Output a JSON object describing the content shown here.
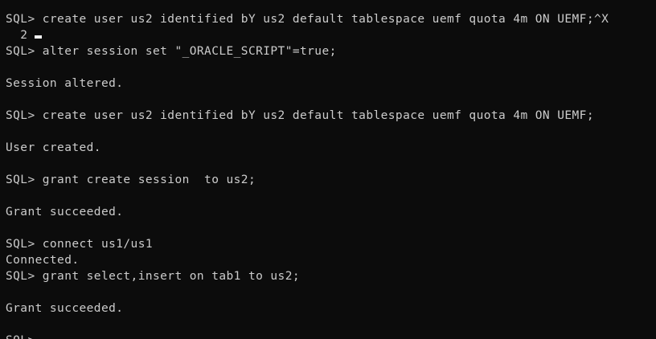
{
  "terminal": {
    "lines": [
      "SQL> create user us2 identified bY us2 default tablespace uemf quota 4m ON UEMF;^X",
      "  2",
      "SQL> alter session set \"_ORACLE_SCRIPT\"=true;",
      "",
      "Session altered.",
      "",
      "SQL> create user us2 identified bY us2 default tablespace uemf quota 4m ON UEMF;",
      "",
      "User created.",
      "",
      "SQL> grant create session  to us2;",
      "",
      "Grant succeeded.",
      "",
      "SQL> connect us1/us1",
      "Connected.",
      "SQL> grant select,insert on tab1 to us2;",
      "",
      "Grant succeeded.",
      "",
      "SQL>"
    ]
  }
}
